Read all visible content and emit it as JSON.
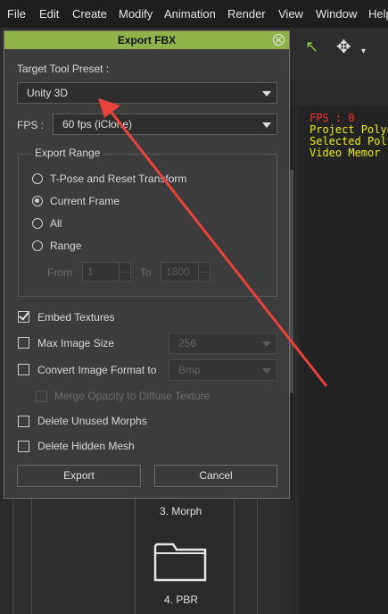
{
  "menubar": {
    "items": [
      "File",
      "Edit",
      "Create",
      "Modify",
      "Animation",
      "Render",
      "View",
      "Window",
      "Help"
    ]
  },
  "overlay": {
    "fps": "FPS : 0",
    "lines": [
      "Project Polyg",
      "Selected Poly",
      "Video Memor"
    ],
    "colors": {
      "fps": "#ff3030",
      "info": "#f0f000"
    }
  },
  "dialog": {
    "title": "Export FBX",
    "preset_label": "Target Tool Preset :",
    "preset_value": "Unity 3D",
    "fps_label": "FPS :",
    "fps_value": "60 fps (iClone)",
    "export_range": {
      "title": "Export Range",
      "options": [
        {
          "label": "T-Pose and Reset Transform",
          "selected": false
        },
        {
          "label": "Current Frame",
          "selected": true
        },
        {
          "label": "All",
          "selected": false
        },
        {
          "label": "Range",
          "selected": false
        }
      ],
      "from_label": "From",
      "from_value": "1",
      "to_label": "To",
      "to_value": "1800"
    },
    "embed_textures": {
      "label": "Embed Textures",
      "checked": true
    },
    "max_image_size": {
      "label": "Max Image Size",
      "checked": false,
      "value": "256"
    },
    "convert_format": {
      "label": "Convert Image Format to",
      "checked": false,
      "value": "Bmp"
    },
    "merge_opacity": {
      "label": "Merge Opacity to Diffuse Texture",
      "checked": false,
      "enabled": false
    },
    "delete_morphs": {
      "label": "Delete Unused Morphs",
      "checked": false
    },
    "delete_mesh": {
      "label": "Delete Hidden Mesh",
      "checked": false
    },
    "export_button": "Export",
    "cancel_button": "Cancel",
    "accent_color": "#8fb34a"
  },
  "background": {
    "items": [
      "3. Morph",
      "4. PBR"
    ]
  },
  "annotation": {
    "arrow_color": "#e8433a"
  }
}
